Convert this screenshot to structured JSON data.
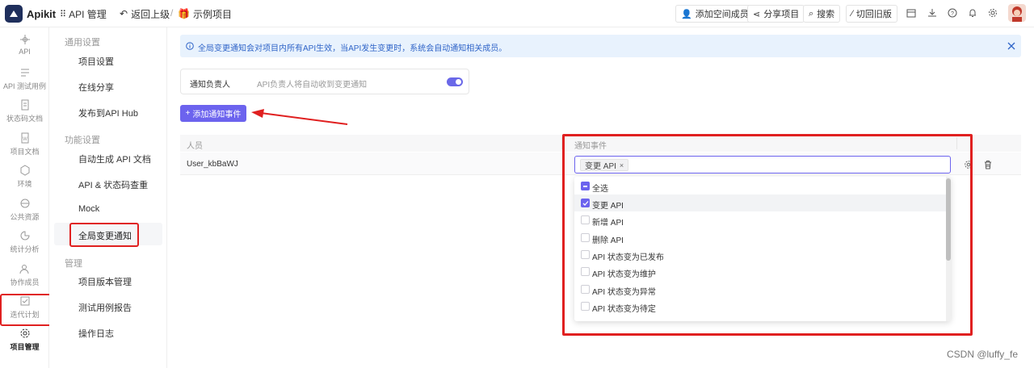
{
  "topbar": {
    "brand": "Apikit",
    "api_manage": "API 管理",
    "back": "返回上级",
    "sep": "/",
    "project": "示例项目",
    "add_member": "添加空间成员",
    "share": "分享项目",
    "search": "搜索",
    "switch_old": "切回旧版"
  },
  "rail": {
    "items": [
      {
        "label": "API",
        "icon": "api-icon"
      },
      {
        "label": "API 测试用例",
        "icon": "test-case-icon"
      },
      {
        "label": "状态码文档",
        "icon": "status-doc-icon"
      },
      {
        "label": "项目文档",
        "icon": "project-doc-icon"
      },
      {
        "label": "环境",
        "icon": "environment-icon"
      },
      {
        "label": "公共资源",
        "icon": "public-resource-icon"
      },
      {
        "label": "统计分析",
        "icon": "statistics-icon"
      },
      {
        "label": "协作成员",
        "icon": "members-icon"
      },
      {
        "label": "迭代计划",
        "icon": "iteration-icon"
      },
      {
        "label": "项目管理",
        "icon": "gear-icon",
        "active": true
      }
    ]
  },
  "sub": {
    "group1": "通用设置",
    "item_project_settings": "项目设置",
    "item_online_share": "在线分享",
    "item_publish": "发布到API Hub",
    "group2": "功能设置",
    "item_auto_gen": "自动生成 API 文档",
    "item_dup_check": "API & 状态码查重",
    "item_mock": "Mock",
    "item_global_notify": "全局变更通知",
    "group3": "管理",
    "item_version": "项目版本管理",
    "item_report": "测试用例报告",
    "item_log": "操作日志"
  },
  "alert": {
    "text": "全局变更通知会对项目内所有API生效，当API发生变更时，系统会自动通知相关成员。"
  },
  "owner_card": {
    "label": "通知负责人",
    "desc": "API负责人将自动收到变更通知",
    "enabled": true
  },
  "add_button": "添加通知事件",
  "table": {
    "col_person": "人员",
    "col_event": "通知事件",
    "rows": [
      {
        "person": "User_kbBaWJ",
        "tag": "变更 API"
      }
    ]
  },
  "dropdown": {
    "options": [
      {
        "label": "全选",
        "state": "partial"
      },
      {
        "label": "变更 API",
        "state": "checked"
      },
      {
        "label": "新增 API",
        "state": "unchecked"
      },
      {
        "label": "删除 API",
        "state": "unchecked"
      },
      {
        "label": "API 状态变为已发布",
        "state": "unchecked"
      },
      {
        "label": "API 状态变为维护",
        "state": "unchecked"
      },
      {
        "label": "API 状态变为异常",
        "state": "unchecked"
      },
      {
        "label": "API 状态变为待定",
        "state": "unchecked"
      }
    ]
  },
  "watermark": "CSDN @luffy_fe",
  "colors": {
    "accent": "#6c63ee",
    "highlight": "#e02020",
    "alert_bg": "#e8f2fd",
    "alert_text": "#2f64c8"
  }
}
